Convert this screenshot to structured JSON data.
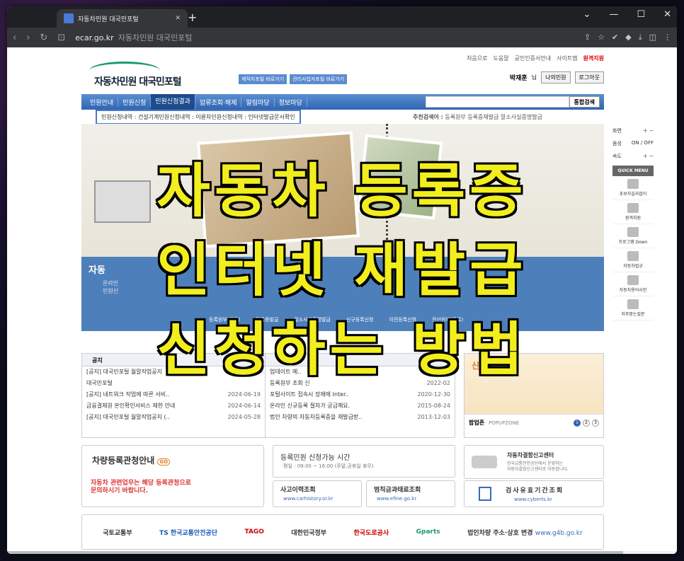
{
  "browser": {
    "tab_title": "자동차민원 대국민포털",
    "new_tab": "+",
    "url_domain": "ecar.go.kr",
    "url_title": "자동차민원 대국민포털",
    "window_controls": [
      "⌄",
      "—",
      "☐",
      "✕"
    ]
  },
  "site": {
    "top_menu": [
      "처음으로",
      "도움말",
      "공인인증서안내",
      "사이트맵"
    ],
    "top_menu_highlight": "원격지원",
    "logo_text": "자동차민원 대국민포털",
    "portal_buttons": [
      "제작자포털 바로가기",
      "관리사업자포털 바로가기"
    ],
    "user_name": "박재훈",
    "user_suffix": "님",
    "user_buttons": [
      "나의민원",
      "로그아웃"
    ],
    "gnb": [
      "민원안내",
      "민원신청",
      "민원신청결과",
      "압류조회·해제",
      "알림마당",
      "정보마당"
    ],
    "search_button": "통합검색",
    "subnav": "민원신청내역 : 건설기계민원신청내역 : 이륜차민원신청내역 : 인터넷발급문서확인",
    "recommend_label": "추천검색어 :",
    "recommend_terms": "등록원부 등록증재발급 말소사실증명발급",
    "blue_title": "자동",
    "blue_desc": "온라인\n민원신",
    "service_icons": [
      "등록원부(무료)",
      "등록증발급",
      "말소사실증명발급",
      "신규등록신청",
      "이전등록신청",
      "전산원부(무료)"
    ],
    "notice_header": "공지",
    "notices": [
      {
        "title": "[공지] 대국민포털 월말작업공지",
        "date": ""
      },
      {
        "title": "대국민포털",
        "date": ""
      },
      {
        "title": "[공지] 네트워크 작업에 따른 서비..",
        "date": "2024-06-19"
      },
      {
        "title": "금융결제원 본인확인서비스 제한 안내",
        "date": "2024-06-14"
      },
      {
        "title": "[공지] 대국민포털 월말작업공지 (..",
        "date": "2024-05-28"
      }
    ],
    "faqs": [
      {
        "title": "업데이트 메..",
        "date": "2022-03"
      },
      {
        "title": "등록원부 조회 신",
        "date": "2022-02"
      },
      {
        "title": "포털사이트 접속시 장애에 Inter..",
        "date": "2020-12-30"
      },
      {
        "title": "온라인 신규등록 절차가 궁금해요.",
        "date": "2015-08-24"
      },
      {
        "title": "법인 차량의 자동차등록증을 재발급받..",
        "date": "2013-12-03"
      }
    ],
    "popup_title": "신청",
    "popup_label": "팝업존",
    "popup_zone": "POPUPZONE",
    "popup_pages": [
      "1",
      "2",
      "3"
    ],
    "car_title": "차량등록관청안내",
    "go": "GO",
    "car_desc": "자동차 관련업무는 해당 등록관청으로\n문의하시기 바랍니다.",
    "reg_title": "등록민원 신청가능 시간",
    "reg_sub": "평일 : 09:00 ~ 16:00 (주말,공휴일 휴무)",
    "history_title": "사고이력조회",
    "history_url": "www.carhistory.or.kr",
    "fine_title": "범칙금과태료조회",
    "fine_url": "www.efine.go.kr",
    "acc_title": "자동차결함신고센터",
    "acc_desc": "한국교통안전공단에서 운영하는\n자동차결함신고센터로 이동합니다.",
    "term_title": "검사유효기간조회",
    "term_url": "www.cyberts.kr",
    "partners": [
      "국토교통부",
      "TS 한국교통안전공단",
      "TAGO",
      "대한민국정부",
      "한국도로공사",
      "Gparts",
      "법인차량 주소·상호 변경"
    ],
    "partner_url": "www.g4b.go.kr"
  },
  "quick": {
    "zoom_label": "화면",
    "sound_label": "음성",
    "sound_value": "ON / OFF",
    "speed_label": "속도",
    "menu_title": "QUICK MENU",
    "items": [
      "초보자길라잡이",
      "원격지원",
      "프로그램 Down",
      "자동차법규",
      "자동차용어사전",
      "자주묻는질문"
    ]
  },
  "overlay": {
    "line1": "자동차 등록증",
    "line2": "인터넷 재발급",
    "line3": "신청하는 방법"
  }
}
